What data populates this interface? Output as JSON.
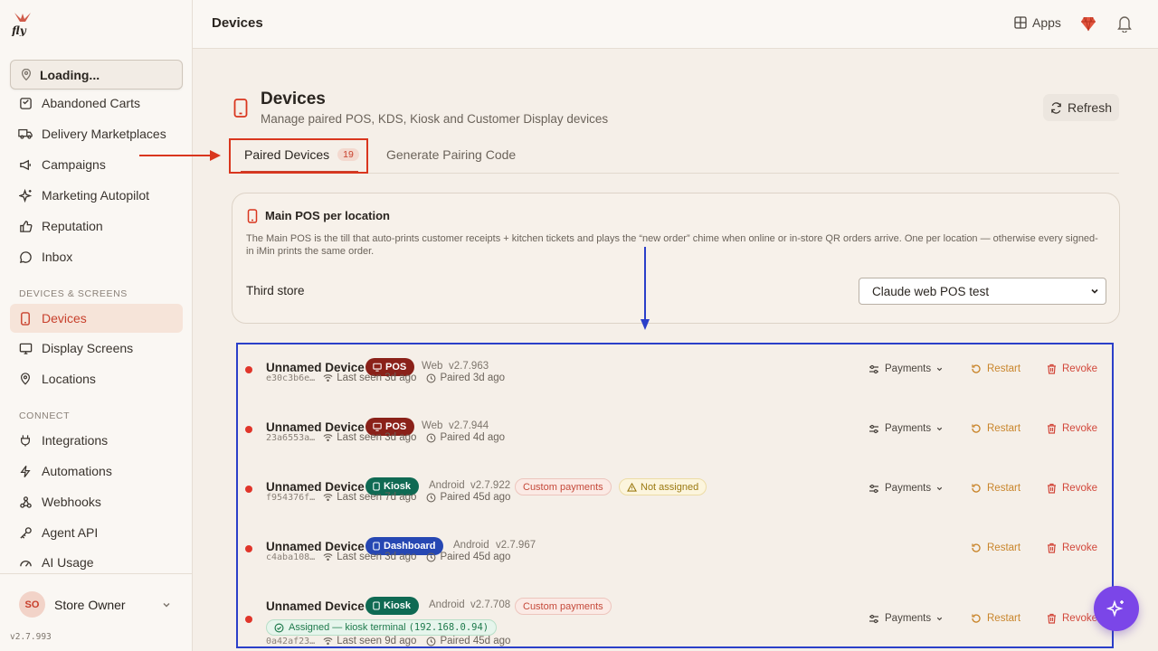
{
  "sidebar": {
    "location_select": "Loading...",
    "items": [
      {
        "label": "Abandoned Carts",
        "icon": "cart-icon"
      },
      {
        "label": "Delivery Marketplaces",
        "icon": "truck-icon"
      },
      {
        "label": "Campaigns",
        "icon": "megaphone-icon"
      },
      {
        "label": "Marketing Autopilot",
        "icon": "sparkle-icon"
      },
      {
        "label": "Reputation",
        "icon": "thumbs-up-icon"
      },
      {
        "label": "Inbox",
        "icon": "chat-icon"
      }
    ],
    "section_devices": "DEVICES & SCREENS",
    "devices_items": [
      {
        "label": "Devices",
        "icon": "tablet-icon",
        "active": true
      },
      {
        "label": "Display Screens",
        "icon": "monitor-icon"
      },
      {
        "label": "Locations",
        "icon": "map-pin-icon"
      }
    ],
    "section_connect": "CONNECT",
    "connect_items": [
      {
        "label": "Integrations",
        "icon": "plug-icon"
      },
      {
        "label": "Automations",
        "icon": "bolt-icon"
      },
      {
        "label": "Webhooks",
        "icon": "webhook-icon"
      },
      {
        "label": "Agent API",
        "icon": "key-icon"
      },
      {
        "label": "AI Usage",
        "icon": "gauge-icon"
      }
    ],
    "user": {
      "initials": "SO",
      "name": "Store Owner"
    },
    "version": "v2.7.993"
  },
  "topbar": {
    "title": "Devices",
    "apps_label": "Apps"
  },
  "page": {
    "title": "Devices",
    "subtitle": "Manage paired POS, KDS, Kiosk and Customer Display devices",
    "refresh_label": "Refresh",
    "tabs": [
      {
        "label": "Paired Devices",
        "count": "19",
        "active": true
      },
      {
        "label": "Generate Pairing Code"
      }
    ]
  },
  "main_pos": {
    "title": "Main POS per location",
    "description": "The Main POS is the till that auto-prints customer receipts + kitchen tickets and plays the “new order” chime when online or in-store QR orders arrive. One per location — otherwise every signed-in iMin prints the same order.",
    "store": "Third store",
    "selected": "Claude web POS test"
  },
  "devices": [
    {
      "name": "Unnamed Device",
      "type": "POS",
      "platform": "Web",
      "version": "v2.7.963",
      "hash": "e30c3b6e…",
      "last_seen": "Last seen 3d ago",
      "paired": "Paired 3d ago",
      "payments": "Payments",
      "restart": "Restart",
      "revoke": "Revoke"
    },
    {
      "name": "Unnamed Device",
      "type": "POS",
      "platform": "Web",
      "version": "v2.7.944",
      "hash": "23a6553a…",
      "last_seen": "Last seen 3d ago",
      "paired": "Paired 4d ago",
      "payments": "Payments",
      "restart": "Restart",
      "revoke": "Revoke"
    },
    {
      "name": "Unnamed Device",
      "type": "Kiosk",
      "platform": "Android",
      "version": "v2.7.922",
      "custom": "Custom payments",
      "warning": "Not assigned",
      "hash": "f954376f…",
      "last_seen": "Last seen 7d ago",
      "paired": "Paired 45d ago",
      "payments": "Payments",
      "restart": "Restart",
      "revoke": "Revoke"
    },
    {
      "name": "Unnamed Device",
      "type": "Dashboard",
      "platform": "Android",
      "version": "v2.7.967",
      "hash": "c4aba108…",
      "last_seen": "Last seen 3d ago",
      "paired": "Paired 45d ago",
      "restart": "Restart",
      "revoke": "Revoke"
    },
    {
      "name": "Unnamed Device",
      "type": "Kiosk",
      "platform": "Android",
      "version": "v2.7.708",
      "custom": "Custom payments",
      "assigned": "Assigned — kiosk terminal",
      "assigned_ip": "(192.168.0.94)",
      "hash": "0a42af23…",
      "last_seen": "Last seen 9d ago",
      "paired": "Paired 45d ago",
      "payments": "Payments",
      "restart": "Restart",
      "revoke": "Revoke"
    }
  ],
  "colors": {
    "accent": "#c8402c",
    "pos_badge": "#8a2119",
    "kiosk_badge": "#0f6a53",
    "dashboard_badge": "#2647b3",
    "status_offline": "#e0352a",
    "annotation_red": "#d9361e",
    "annotation_blue": "#2b3fc9",
    "fab": "#7b46e8"
  }
}
